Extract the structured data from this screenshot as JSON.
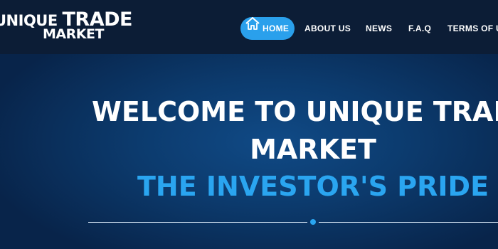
{
  "logo": {
    "line1_part1": "UNIQUE ",
    "line1_part2": "TRADE",
    "line2": "MARKET"
  },
  "nav": [
    {
      "label": "HOME",
      "active": true,
      "icon": "home-icon"
    },
    {
      "label": "ABOUT US"
    },
    {
      "label": "NEWS"
    },
    {
      "label": "F.A.Q"
    },
    {
      "label": "TERMS OF U"
    }
  ],
  "hero": {
    "title_line1": "WELCOME TO UNIQUE TRADE",
    "title_line2": "MARKET",
    "subtitle": "THE INVESTOR'S PRIDE"
  },
  "colors": {
    "accent": "#2aa0ec",
    "navbar_bg": "#0c1d36",
    "hero_bg": "#0c3b6e"
  }
}
